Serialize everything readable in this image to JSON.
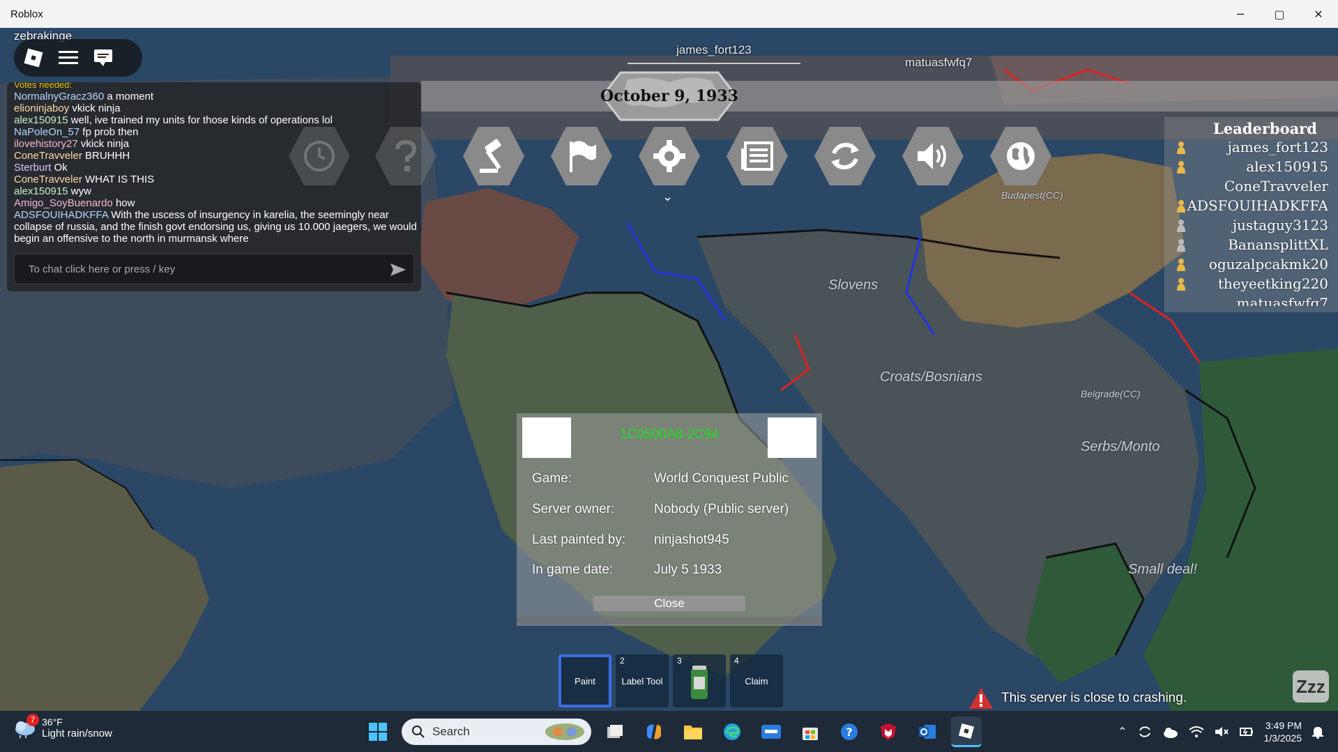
{
  "window": {
    "title": "Roblox",
    "minimize": "─",
    "maximize": "▢",
    "close": "✕"
  },
  "player": {
    "username": "zebrakinge"
  },
  "world_tags": {
    "p1": "james_fort123",
    "p2": "matuasfwfq7"
  },
  "chat": {
    "votes_header": "Votes needed:",
    "lines": [
      {
        "name": "NormalnyGracz360",
        "text": "a moment"
      },
      {
        "name": "elioninjaboy",
        "text": "vkick ninja"
      },
      {
        "name": "alex150915",
        "text": "well, ive trained my units for those kinds of operations lol"
      },
      {
        "name": "NaPoleOn_57",
        "text": "fp prob then"
      },
      {
        "name": "ilovehistory27",
        "text": "vkick ninja"
      },
      {
        "name": "ConeTravveler",
        "text": "BRUHHH"
      },
      {
        "name": "Sterburt",
        "text": "Ok"
      },
      {
        "name": "ConeTravveler",
        "text": "WHAT IS THIS"
      },
      {
        "name": "alex150915",
        "text": "wyw"
      },
      {
        "name": "Amigo_SoyBuenardo",
        "text": "how"
      },
      {
        "name": "ADSFOUIHADKFFA",
        "text": "With the uscess of insurgency in karelia, the seemingly near collapse of russia, and the finish govt endorsing us, giving us 10.000 jaegers, we would begin an offensive to the north in murmansk where"
      }
    ],
    "input_placeholder": "To chat click here or press / key"
  },
  "date_banner": "October 9, 1933",
  "leaderboard": {
    "title": "Leaderboard",
    "players": [
      "james_fort123",
      "alex150915",
      "ConeTravveler",
      "ADSFOUIHADKFFA",
      "justaguy3123",
      "BanansplittXL",
      "oguzalpcakmk20",
      "theyeetking220",
      "matuasfwfq7"
    ],
    "rank_colors": [
      "#e8b84a",
      "#e8b84a",
      "",
      "#e8b84a",
      "#bbbbbb",
      "#bbbbbb",
      "#e8b84a",
      "#e8b84a",
      ""
    ]
  },
  "map_labels": {
    "budapest": "Budapest(CC)",
    "slovens": "Slovens",
    "croats": "Croats/Bosnians",
    "belgrade": "Belgrade(CC)",
    "serbs": "Serbs/Monto",
    "small_deal": "Small deal!"
  },
  "info_dialog": {
    "server_code": "1C0500A8-2C94",
    "rows": [
      {
        "label": "Game:",
        "value": "World Conquest Public"
      },
      {
        "label": "Server owner:",
        "value": "Nobody (Public server)"
      },
      {
        "label": "Last painted by:",
        "value": "ninjashot945"
      },
      {
        "label": "In game date:",
        "value": "July 5 1933"
      }
    ],
    "close_label": "Close"
  },
  "hotbar": [
    {
      "num": "",
      "label": "Paint"
    },
    {
      "num": "2",
      "label": "Label Tool"
    },
    {
      "num": "3",
      "label": ""
    },
    {
      "num": "4",
      "label": "Claim"
    }
  ],
  "warning": "This server is close to crashing.",
  "idle_badge": "Zzz",
  "taskbar": {
    "weather_badge": "7",
    "temperature": "36°F",
    "condition": "Light rain/snow",
    "search_placeholder": "Search",
    "time": "3:49 PM",
    "date": "1/3/2025"
  }
}
